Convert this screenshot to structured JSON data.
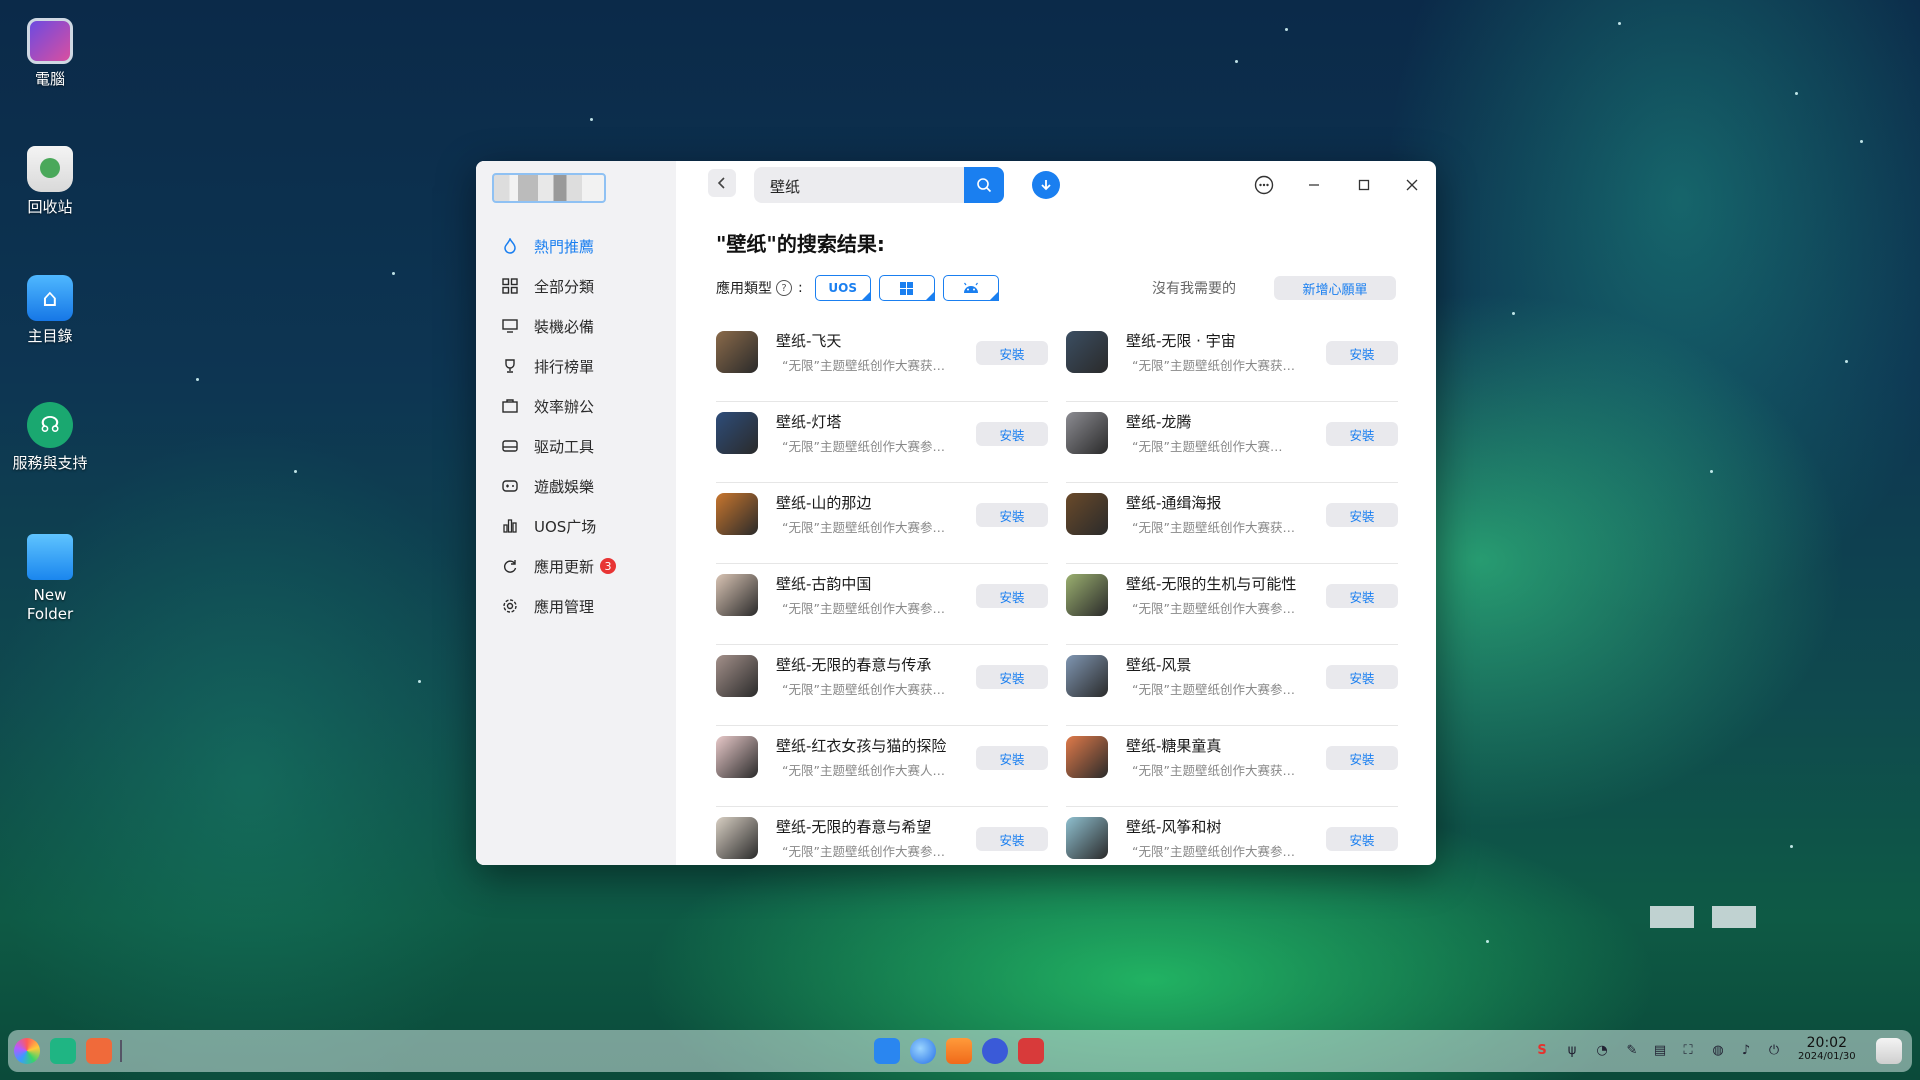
{
  "desktop": {
    "icons": [
      {
        "label": "電腦"
      },
      {
        "label": "回收站"
      },
      {
        "label": "主目錄"
      },
      {
        "label": "服務與支持"
      },
      {
        "label": "New Folder"
      }
    ]
  },
  "window": {
    "sidebar": {
      "items": [
        {
          "label": "熱門推薦",
          "icon": "flame-icon"
        },
        {
          "label": "全部分類",
          "icon": "grid-icon"
        },
        {
          "label": "裝機必備",
          "icon": "monitor-icon"
        },
        {
          "label": "排行榜單",
          "icon": "trophy-icon"
        },
        {
          "label": "效率辦公",
          "icon": "briefcase-icon"
        },
        {
          "label": "驱动工具",
          "icon": "drive-icon"
        },
        {
          "label": "遊戲娛樂",
          "icon": "gamepad-icon"
        },
        {
          "label": "UOS广场",
          "icon": "chart-icon"
        },
        {
          "label": "應用更新",
          "icon": "refresh-icon",
          "badge": "3"
        },
        {
          "label": "應用管理",
          "icon": "gear-icon"
        }
      ]
    },
    "search": {
      "value": "壁纸"
    },
    "results_title": "\"壁纸\"的搜索结果:",
    "filter": {
      "label": "應用類型",
      "chips": [
        "UOS",
        "windows",
        "android"
      ],
      "need_text": "沒有我需要的",
      "wish_button": "新增心願單"
    },
    "apps": [
      {
        "name": "壁纸-飞天",
        "desc": "“无限”主题壁纸创作大赛获…",
        "install": "安裝",
        "color": "#8a6a4a"
      },
      {
        "name": "壁纸-无限 · 宇宙",
        "desc": "“无限”主题壁纸创作大赛获…",
        "install": "安裝",
        "color": "#3b4e62"
      },
      {
        "name": "壁纸-灯塔",
        "desc": "“无限”主题壁纸创作大赛参…",
        "install": "安裝",
        "color": "#2e4d7a"
      },
      {
        "name": "壁纸-龙腾",
        "desc": "“无限”主题壁纸创作大赛…",
        "install": "安裝",
        "color": "#8c8c92"
      },
      {
        "name": "壁纸-山的那边",
        "desc": "“无限”主题壁纸创作大赛参…",
        "install": "安裝",
        "color": "#c8762e"
      },
      {
        "name": "壁纸-通缉海报",
        "desc": "“无限”主题壁纸创作大赛获…",
        "install": "安裝",
        "color": "#6a4a2a"
      },
      {
        "name": "壁纸-古韵中国",
        "desc": "“无限”主题壁纸创作大赛参…",
        "install": "安裝",
        "color": "#d9c4b4"
      },
      {
        "name": "壁纸-无限的生机与可能性",
        "desc": "“无限”主题壁纸创作大赛参…",
        "install": "安裝",
        "color": "#9bb070"
      },
      {
        "name": "壁纸-无限的春意与传承",
        "desc": "“无限”主题壁纸创作大赛获…",
        "install": "安裝",
        "color": "#a3908a"
      },
      {
        "name": "壁纸-风景",
        "desc": "“无限”主题壁纸创作大赛参…",
        "install": "安裝",
        "color": "#7f96b2"
      },
      {
        "name": "壁纸-红衣女孩与猫的探险",
        "desc": "“无限”主题壁纸创作大赛人…",
        "install": "安裝",
        "color": "#e8c9c9"
      },
      {
        "name": "壁纸-糖果童真",
        "desc": "“无限”主题壁纸创作大赛获…",
        "install": "安裝",
        "color": "#e07a4a"
      },
      {
        "name": "壁纸-无限的春意与希望",
        "desc": "“无限”主题壁纸创作大赛参…",
        "install": "安裝",
        "color": "#d8cfc3"
      },
      {
        "name": "壁纸-风筝和树",
        "desc": "“无限”主题壁纸创作大赛参…",
        "install": "安裝",
        "color": "#8fc0d0"
      }
    ]
  },
  "taskbar": {
    "clock_time": "20:02",
    "clock_date": "2024/01/30"
  },
  "colors": {
    "accent": "#1a7ff0",
    "badge": "#e83434"
  }
}
